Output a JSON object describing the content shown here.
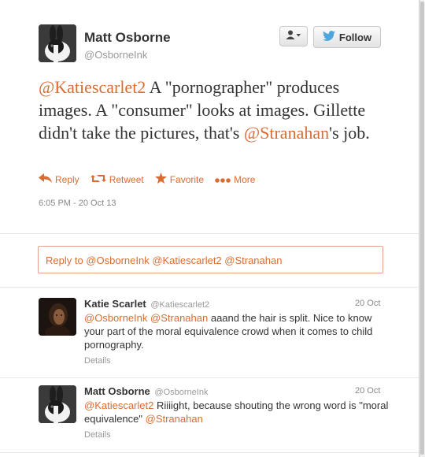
{
  "main_tweet": {
    "name": "Matt Osborne",
    "handle": "@OsborneInk",
    "follow_label": "Follow",
    "text_parts": {
      "m1": "@Katiescarlet2",
      "t1": " A \"pornographer\" produces images. A \"consumer\" looks at images. Gillette didn't take the pictures, that's ",
      "m2": "@Stranahan",
      "t2": "'s job."
    },
    "actions": {
      "reply": "Reply",
      "retweet": "Retweet",
      "favorite": "Favorite",
      "more": "More"
    },
    "timestamp": "6:05 PM - 20 Oct 13"
  },
  "reply_box": {
    "label": "Reply to @OsborneInk @Katiescarlet2 @Stranahan"
  },
  "replies": [
    {
      "name": "Katie Scarlet",
      "handle": "@Katiescarlet2",
      "date": "20 Oct",
      "m1": "@OsborneInk",
      "m2": "@Stranahan",
      "text": " aaand the hair is split. Nice to know your part of the moral equivalence crowd when it comes to child pornography.",
      "details": "Details"
    },
    {
      "name": "Matt Osborne",
      "handle": "@OsborneInk",
      "date": "20 Oct",
      "m1": "@Katiescarlet2",
      "text": " Riiiight, because shouting the wrong word is \"moral equivalence\" ",
      "m2": "@Stranahan",
      "details": "Details"
    }
  ],
  "colors": {
    "accent": "#d96c33",
    "follow_bird": "#4da7de"
  },
  "icons": [
    "person-dropdown-icon",
    "twitter-bird-icon",
    "reply-icon",
    "retweet-icon",
    "star-icon",
    "more-dots-icon"
  ]
}
